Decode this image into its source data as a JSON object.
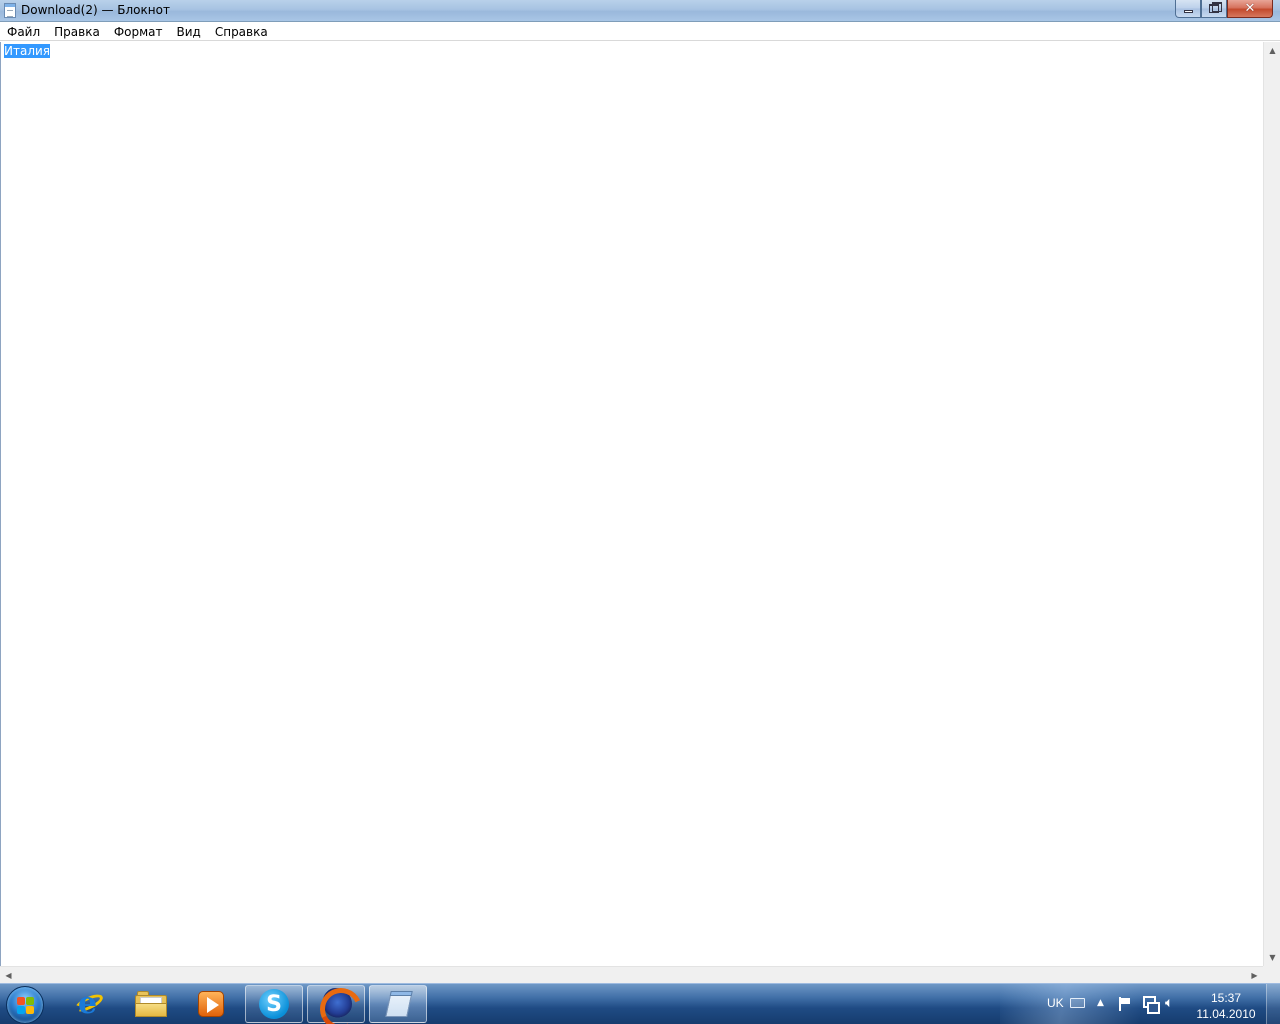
{
  "window": {
    "title": "Download(2) — Блокнот"
  },
  "menu": {
    "items": [
      "Файл",
      "Правка",
      "Формат",
      "Вид",
      "Справка"
    ]
  },
  "editor": {
    "selected_text": "Италия"
  },
  "taskbar": {
    "pinned": [
      {
        "name": "Internet Explorer",
        "icon": "ie-icon"
      },
      {
        "name": "Windows Explorer",
        "icon": "folder-icon"
      },
      {
        "name": "Windows Media Player",
        "icon": "media-player-icon"
      },
      {
        "name": "Skype",
        "icon": "skype-icon"
      },
      {
        "name": "Mozilla Firefox",
        "icon": "firefox-icon"
      },
      {
        "name": "Блокнот",
        "icon": "notepad-icon"
      }
    ],
    "skype_letter": "S",
    "tray": {
      "language": "UK",
      "time": "15:37",
      "date": "11.04.2010"
    }
  }
}
